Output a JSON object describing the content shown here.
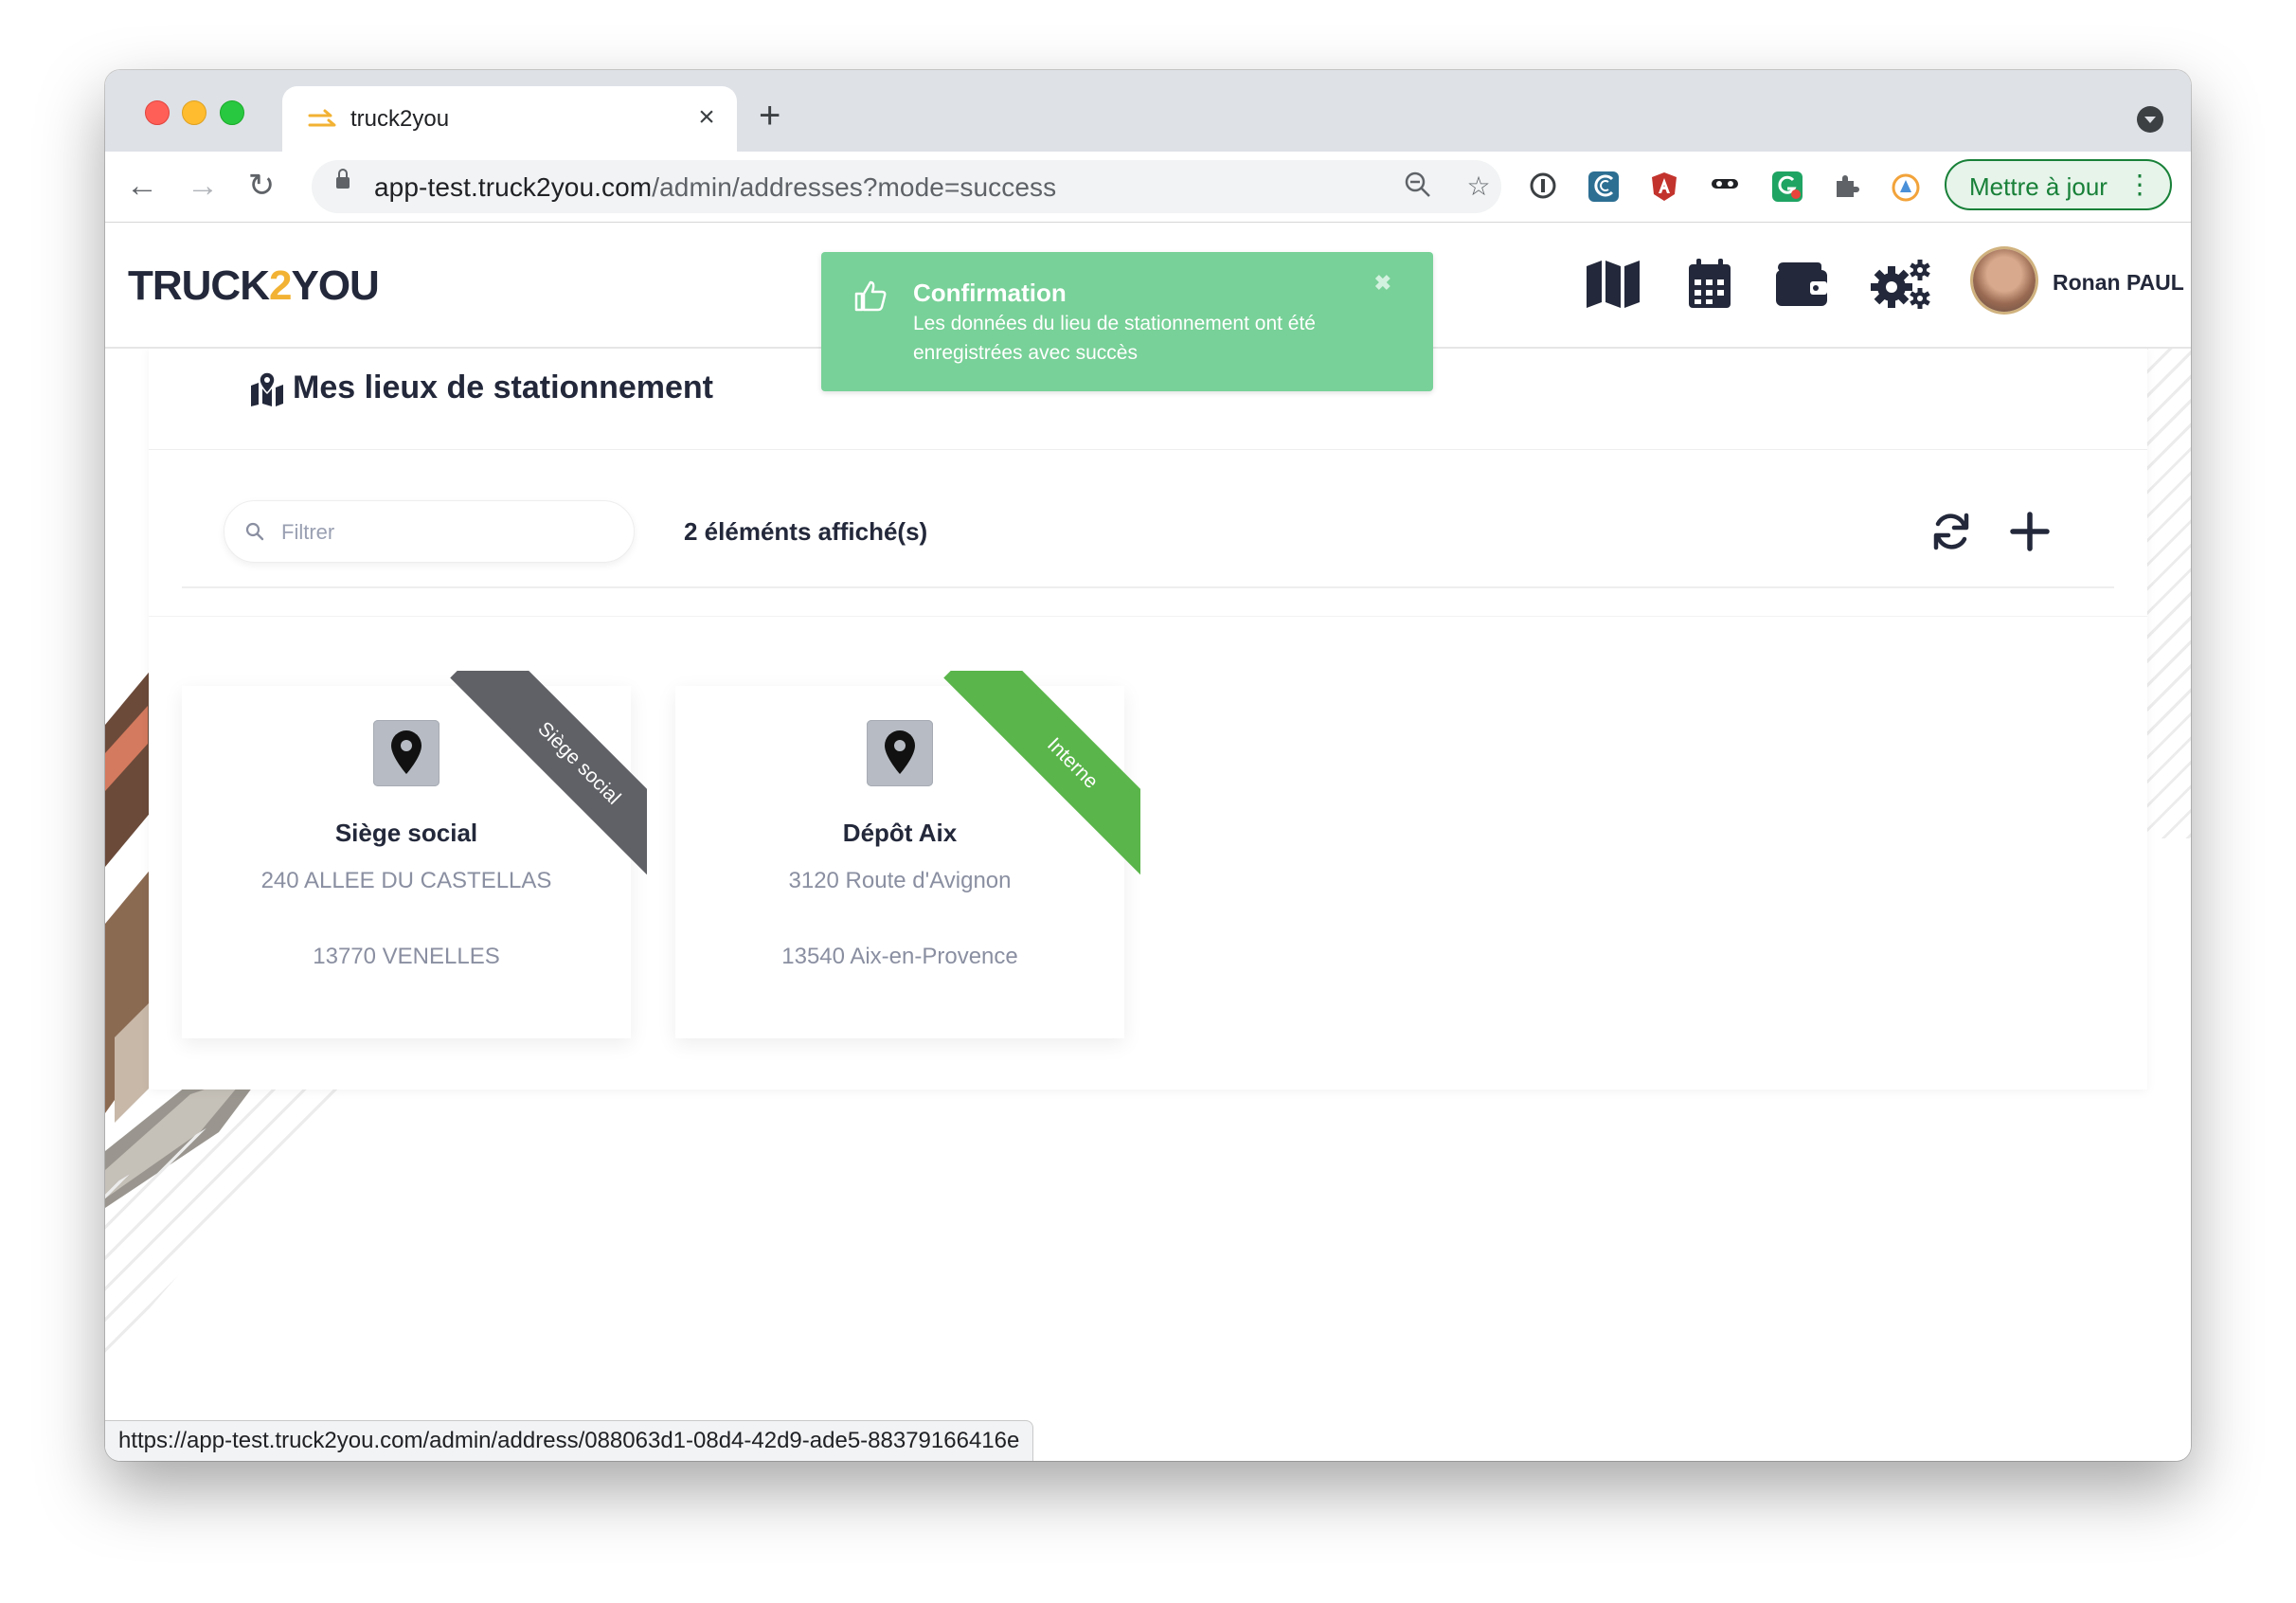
{
  "browser": {
    "tab_title": "truck2you",
    "url_domain": "app-test.truck2you.com",
    "url_path": "/admin/addresses?mode=success",
    "update_button": "Mettre à jour",
    "status_url": "https://app-test.truck2you.com/admin/address/088063d1-08d4-42d9-ade5-88379166416e"
  },
  "header": {
    "logo_left": "TRUCK",
    "logo_mid": "2",
    "logo_right": "YOU",
    "user_name": "Ronan PAUL",
    "icons": [
      "map-icon",
      "calendar-icon",
      "wallet-icon",
      "settings-icon"
    ]
  },
  "toast": {
    "title": "Confirmation",
    "message": "Les données du lieu de stationnement ont été enregistrées avec succès",
    "close": "✖"
  },
  "panel": {
    "title": "Mes lieux de stationnement",
    "filter_placeholder": "Filtrer",
    "count_text": "2 éléménts affiché(s)"
  },
  "places": [
    {
      "name": "Siège social",
      "line1": "240 ALLEE DU CASTELLAS",
      "line2": "13770 VENELLES",
      "ribbon": "Siège social",
      "ribbon_color": "#606166"
    },
    {
      "name": "Dépôt Aix",
      "line1": "3120 Route d'Avignon",
      "line2": "13540 Aix-en-Provence",
      "ribbon": "Interne",
      "ribbon_color": "#5ab54a"
    }
  ],
  "colors": {
    "toast_bg": "#78d198",
    "text_dark": "#23283a",
    "text_muted": "#8a8fa1",
    "logo_accent": "#f2b233"
  }
}
